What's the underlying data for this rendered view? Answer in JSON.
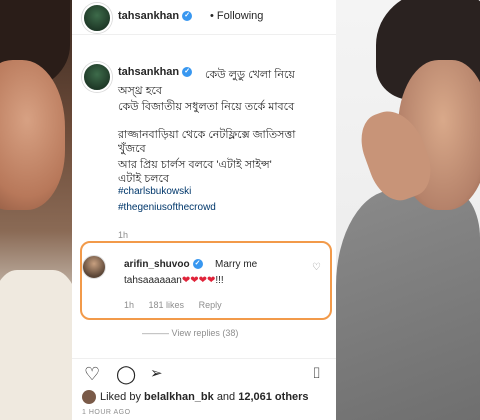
{
  "header": {
    "username": "tahsankhan",
    "follow_status": "Following"
  },
  "caption": {
    "username": "tahsankhan",
    "line1": "কেউ লুডু খেলা নিয়ে",
    "line2": "অস্থ্র হবে",
    "line3": "কেউ বিজাতীয় সধুলতা নিয়ে তর্কে মাববে",
    "line4": "রাজ্জানবাড়িয়া থেকে নেটফ্লিক্সে জাতিসত্তা",
    "line5": "খুঁজবে",
    "line6": "আর প্রিয় চার্লস বলবে 'এটাই সাইন্স'",
    "line7": "এটাই চলবে",
    "hashtags": [
      "#charlsbukowski",
      "#thegeniusofthecrowd"
    ],
    "time": "1h"
  },
  "comment": {
    "username": "arifin_shuvoo",
    "text": "Marry me",
    "line2_prefix": "tahsaaaaaan",
    "hearts": "❤❤❤❤",
    "line2_suffix": "!!!",
    "time": "1h",
    "likes": "181 likes",
    "reply": "Reply",
    "view_replies": "View replies (38)"
  },
  "likes": {
    "prefix": "Liked by",
    "user": "belalkhan_bk",
    "middle": "and",
    "others": "12,061 others"
  },
  "posted_ago": "1 HOUR AGO",
  "colors": {
    "highlight_border": "#f29a4a",
    "verified": "#3897f0",
    "hashtag": "#00376b",
    "heart": "#e0243a"
  }
}
